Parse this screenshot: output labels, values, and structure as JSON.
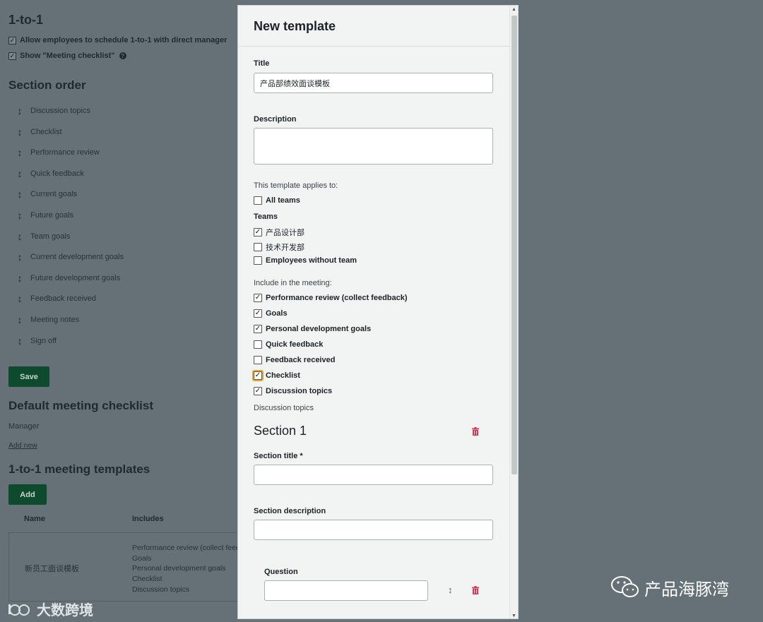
{
  "background": {
    "one_to_one_heading": "1-to-1",
    "settings": [
      {
        "label": "Allow employees to schedule 1-to-1 with direct manager",
        "checked": true
      },
      {
        "label": "Show \"Meeting checklist\"",
        "checked": true
      }
    ],
    "section_order_heading": "Section order",
    "section_order": [
      "Discussion topics",
      "Checklist",
      "Performance review",
      "Quick feedback",
      "Current goals",
      "Future goals",
      "Team goals",
      "Current development goals",
      "Future development goals",
      "Feedback received",
      "Meeting notes",
      "Sign off"
    ],
    "save_label": "Save",
    "checklist_heading": "Default meeting checklist",
    "checklist_role": "Manager",
    "add_new_label": "Add new",
    "templates_heading": "1-to-1 meeting templates",
    "add_label": "Add",
    "table": {
      "headers": [
        "Name",
        "Includes"
      ],
      "rows": [
        {
          "name": "新员工面谈模板",
          "includes": [
            "Performance review (collect feed",
            "Goals",
            "Personal development goals",
            "Checklist",
            "Discussion topics"
          ]
        }
      ]
    }
  },
  "modal": {
    "title": "New template",
    "title_label": "Title",
    "title_value": "产品部绩效面谈模板",
    "description_label": "Description",
    "applies_caption": "This template applies to:",
    "all_teams": {
      "label": "All teams",
      "checked": false
    },
    "teams_label": "Teams",
    "teams": [
      {
        "label": "产品设计部",
        "checked": true
      },
      {
        "label": "技术开发部",
        "checked": false
      },
      {
        "label": "Employees without team",
        "checked": false
      }
    ],
    "include_caption": "Include in the meeting:",
    "include": [
      {
        "label": "Performance review (collect feedback)",
        "checked": true
      },
      {
        "label": "Goals",
        "checked": true
      },
      {
        "label": "Personal development goals",
        "checked": true
      },
      {
        "label": "Quick feedback",
        "checked": false
      },
      {
        "label": "Feedback received",
        "checked": false
      },
      {
        "label": "Checklist",
        "checked": true,
        "focused": true
      },
      {
        "label": "Discussion topics",
        "checked": true
      }
    ],
    "discussion_caption": "Discussion topics",
    "section_heading": "Section 1",
    "section_title_label": "Section title *",
    "section_description_label": "Section description",
    "question_label": "Question"
  },
  "watermarks": {
    "left": "大数跨境",
    "right": "产品海豚湾"
  },
  "colors": {
    "overlay": "#657077",
    "primary_button": "#0d4a2e",
    "delete_icon": "#d9364f",
    "move_icon": "#2e7d4f",
    "focus_outline": "#e0a82e"
  }
}
